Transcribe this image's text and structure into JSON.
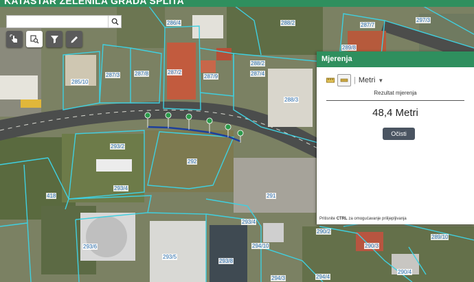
{
  "app": {
    "title": "KATASTAR ZELENILA GRADA SPLITA",
    "accent": "#2f8f5e",
    "parcel_line_color": "#3fd0e0"
  },
  "search": {
    "placeholder": "",
    "icon": "search-icon"
  },
  "toolbar": [
    {
      "name": "identify-tool-button",
      "icon": "hand-pointer-icon",
      "active": true
    },
    {
      "name": "layers-tool-button",
      "icon": "layers-search-icon"
    },
    {
      "name": "filter-tool-button",
      "icon": "filter-icon"
    },
    {
      "name": "edit-tool-button",
      "icon": "pencil-icon"
    }
  ],
  "panel": {
    "title": "Mjerenja",
    "unit_label": "Metri",
    "result_label": "Rezultat mjerenja",
    "result_value": "48,4 Metri",
    "clear_button": "Očisti",
    "hint_prefix": "Pritisnite ",
    "hint_key": "CTRL",
    "hint_suffix": " za omogućavanje prilijepljivanja"
  },
  "parcels": [
    "286/4",
    "288/2",
    "297/3",
    "287/7",
    "289/8",
    "287/3",
    "287/8",
    "287/2",
    "287/9",
    "288/2",
    "287/4",
    "285/10",
    "288/3",
    "293/2",
    "292",
    "293/4",
    "418",
    "291",
    "293/4",
    "290/2",
    "290/3",
    "289/10",
    "293/6",
    "293/5",
    "293/8",
    "294/10",
    "294/3",
    "294/4",
    "290/4"
  ],
  "markers": 8
}
